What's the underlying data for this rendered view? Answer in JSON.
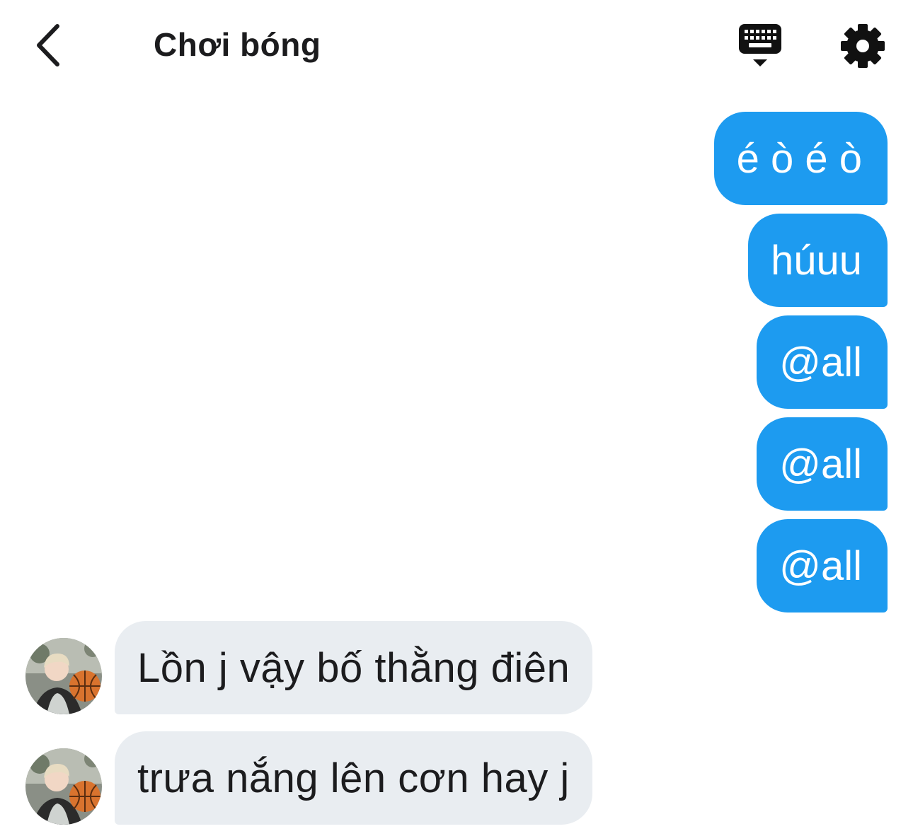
{
  "header": {
    "title": "Chơi bóng",
    "back_icon": "chevron-left-icon",
    "keyboard_icon": "keyboard-icon",
    "settings_icon": "gear-icon"
  },
  "colors": {
    "outgoing_bubble": "#1d9bf0",
    "incoming_bubble": "#e9edf1",
    "text_dark": "#1c1c1e"
  },
  "messages": [
    {
      "direction": "outgoing",
      "text": "é ò é ò"
    },
    {
      "direction": "outgoing",
      "text": "húuu"
    },
    {
      "direction": "outgoing",
      "text": "@all"
    },
    {
      "direction": "outgoing",
      "text": "@all"
    },
    {
      "direction": "outgoing",
      "text": "@all"
    },
    {
      "direction": "incoming",
      "text": "Lồn j vậy bố thằng điên"
    },
    {
      "direction": "incoming",
      "text": "trưa nắng lên cơn hay j"
    }
  ]
}
